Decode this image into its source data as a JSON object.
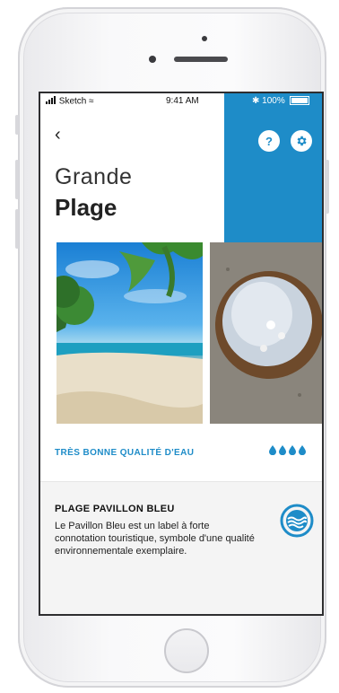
{
  "status_bar": {
    "carrier": "Sketch",
    "time": "9:41 AM",
    "battery": "100%"
  },
  "header": {
    "back_icon": "chevron-left-icon",
    "title_line1": "Grande",
    "title_line2": "Plage",
    "info_label": "?"
  },
  "images": [
    {
      "name": "tropical-beach-photo"
    },
    {
      "name": "pearl-oyster-photo"
    }
  ],
  "water_quality": {
    "label": "TRÈS BONNE QUALITÉ D'EAU",
    "drops": 4
  },
  "blue_flag": {
    "title": "PLAGE PAVILLON BLEU",
    "description": "Le Pavillon Bleu est un label à forte connotation touristique, symbole d'une qualité environnementale exemplaire."
  },
  "colors": {
    "accent": "#1e8cc8"
  }
}
